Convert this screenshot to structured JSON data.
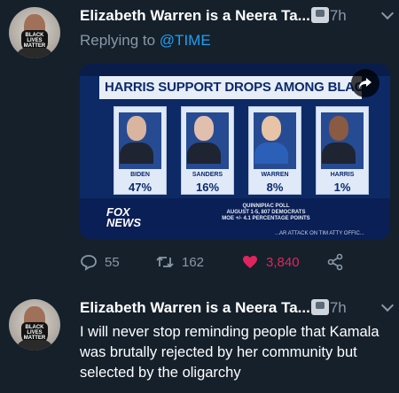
{
  "tweets": [
    {
      "author": "Elizabeth Warren is a Neera Ta...",
      "time": "7h",
      "replying_label": "Replying to",
      "replying_handle": "@TIME",
      "avatar_mask_text": "BLACK LIVES MATTER",
      "media": {
        "banner": "HARRIS SUPPORT DROPS AMONG BLACK VOTERS",
        "candidates": [
          {
            "name": "BIDEN",
            "percent": "47%"
          },
          {
            "name": "SANDERS",
            "percent": "16%"
          },
          {
            "name": "WARREN",
            "percent": "8%"
          },
          {
            "name": "HARRIS",
            "percent": "1%"
          }
        ],
        "logo": "FOX NEWS",
        "poll_lines": [
          "QUINNIPIAC POLL",
          "AUGUST 1-5, 807 DEMOCRATS",
          "MOE +/- 4.1 PERCENTAGE POINTS"
        ],
        "ticker": "...AR ATTACK ON TIM ATTY OFFIC..."
      },
      "actions": {
        "replies": "55",
        "retweets": "162",
        "likes": "3,840"
      },
      "colors": {
        "likes": "#e0245e",
        "link": "#1da1f2",
        "muted": "#8899a6"
      }
    },
    {
      "author": "Elizabeth Warren is a Neera Ta...",
      "time": "7h",
      "text": "I will never stop reminding people that Kamala was brutally rejected by her community but selected by the oligarchy",
      "avatar_mask_text": "BLACK LIVES MATTER"
    }
  ]
}
